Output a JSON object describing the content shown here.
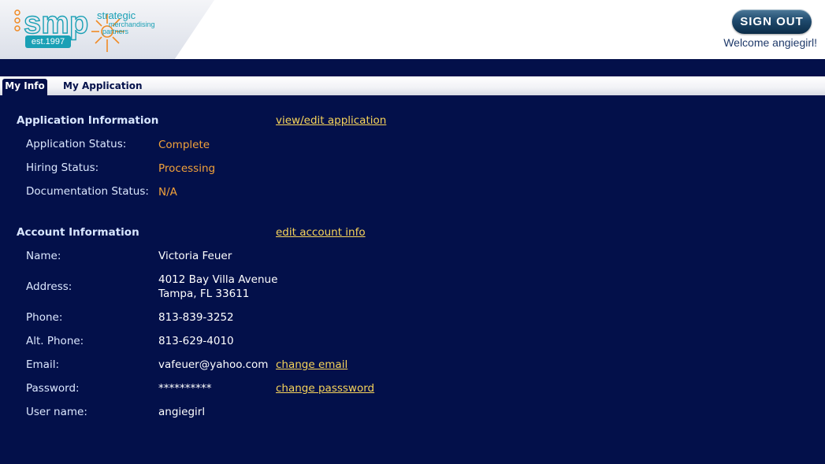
{
  "logo": {
    "wordmark": "smp",
    "tagline_line1": "strategic",
    "tagline_line2": "merchandising",
    "tagline_line3": "partners",
    "est": "est.1997"
  },
  "header": {
    "signout_label": "SIGN OUT",
    "welcome_text": "Welcome angiegirl!"
  },
  "tabs": [
    {
      "label": "My Info",
      "active": true
    },
    {
      "label": "My Application",
      "active": false
    }
  ],
  "application_info": {
    "title": "Application Information",
    "link": "view/edit application",
    "rows": [
      {
        "label": "Application Status:",
        "value": "Complete"
      },
      {
        "label": "Hiring Status:",
        "value": "Processing"
      },
      {
        "label": "Documentation Status:",
        "value": "N/A"
      }
    ]
  },
  "account_info": {
    "title": "Account Information",
    "link": "edit account info",
    "name_label": "Name:",
    "name": "Victoria Feuer",
    "address_label": "Address:",
    "address_line1": "4012 Bay Villa Avenue",
    "address_line2": "Tampa, FL 33611",
    "phone_label": "Phone:",
    "phone": "813-839-3252",
    "alt_phone_label": "Alt. Phone:",
    "alt_phone": "813-629-4010",
    "email_label": "Email:",
    "email": "vafeuer@yahoo.com",
    "change_email": "change email",
    "password_label": "Password:",
    "password": "**********",
    "change_password": "change passsword",
    "username_label": "User name:",
    "username": "angiegirl"
  },
  "colors": {
    "background": "#03104a",
    "status_orange": "#f2a23a",
    "link_yellow": "#f7d45a"
  }
}
